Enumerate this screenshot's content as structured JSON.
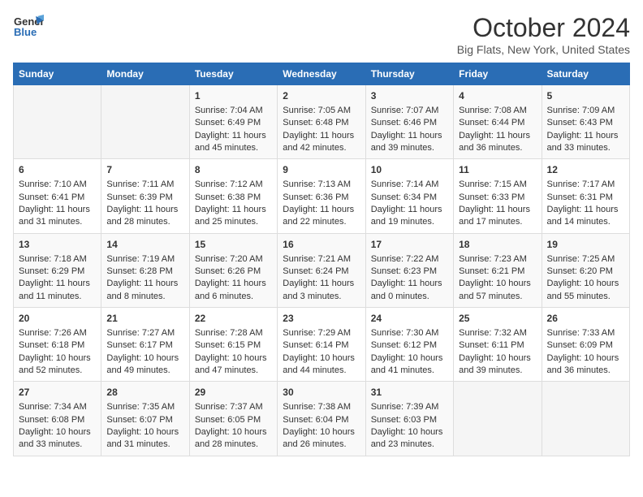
{
  "header": {
    "logo_general": "General",
    "logo_blue": "Blue",
    "month": "October 2024",
    "location": "Big Flats, New York, United States"
  },
  "days_of_week": [
    "Sunday",
    "Monday",
    "Tuesday",
    "Wednesday",
    "Thursday",
    "Friday",
    "Saturday"
  ],
  "weeks": [
    [
      {
        "day": "",
        "empty": true
      },
      {
        "day": "",
        "empty": true
      },
      {
        "day": "1",
        "sunrise": "Sunrise: 7:04 AM",
        "sunset": "Sunset: 6:49 PM",
        "daylight": "Daylight: 11 hours and 45 minutes."
      },
      {
        "day": "2",
        "sunrise": "Sunrise: 7:05 AM",
        "sunset": "Sunset: 6:48 PM",
        "daylight": "Daylight: 11 hours and 42 minutes."
      },
      {
        "day": "3",
        "sunrise": "Sunrise: 7:07 AM",
        "sunset": "Sunset: 6:46 PM",
        "daylight": "Daylight: 11 hours and 39 minutes."
      },
      {
        "day": "4",
        "sunrise": "Sunrise: 7:08 AM",
        "sunset": "Sunset: 6:44 PM",
        "daylight": "Daylight: 11 hours and 36 minutes."
      },
      {
        "day": "5",
        "sunrise": "Sunrise: 7:09 AM",
        "sunset": "Sunset: 6:43 PM",
        "daylight": "Daylight: 11 hours and 33 minutes."
      }
    ],
    [
      {
        "day": "6",
        "sunrise": "Sunrise: 7:10 AM",
        "sunset": "Sunset: 6:41 PM",
        "daylight": "Daylight: 11 hours and 31 minutes."
      },
      {
        "day": "7",
        "sunrise": "Sunrise: 7:11 AM",
        "sunset": "Sunset: 6:39 PM",
        "daylight": "Daylight: 11 hours and 28 minutes."
      },
      {
        "day": "8",
        "sunrise": "Sunrise: 7:12 AM",
        "sunset": "Sunset: 6:38 PM",
        "daylight": "Daylight: 11 hours and 25 minutes."
      },
      {
        "day": "9",
        "sunrise": "Sunrise: 7:13 AM",
        "sunset": "Sunset: 6:36 PM",
        "daylight": "Daylight: 11 hours and 22 minutes."
      },
      {
        "day": "10",
        "sunrise": "Sunrise: 7:14 AM",
        "sunset": "Sunset: 6:34 PM",
        "daylight": "Daylight: 11 hours and 19 minutes."
      },
      {
        "day": "11",
        "sunrise": "Sunrise: 7:15 AM",
        "sunset": "Sunset: 6:33 PM",
        "daylight": "Daylight: 11 hours and 17 minutes."
      },
      {
        "day": "12",
        "sunrise": "Sunrise: 7:17 AM",
        "sunset": "Sunset: 6:31 PM",
        "daylight": "Daylight: 11 hours and 14 minutes."
      }
    ],
    [
      {
        "day": "13",
        "sunrise": "Sunrise: 7:18 AM",
        "sunset": "Sunset: 6:29 PM",
        "daylight": "Daylight: 11 hours and 11 minutes."
      },
      {
        "day": "14",
        "sunrise": "Sunrise: 7:19 AM",
        "sunset": "Sunset: 6:28 PM",
        "daylight": "Daylight: 11 hours and 8 minutes."
      },
      {
        "day": "15",
        "sunrise": "Sunrise: 7:20 AM",
        "sunset": "Sunset: 6:26 PM",
        "daylight": "Daylight: 11 hours and 6 minutes."
      },
      {
        "day": "16",
        "sunrise": "Sunrise: 7:21 AM",
        "sunset": "Sunset: 6:24 PM",
        "daylight": "Daylight: 11 hours and 3 minutes."
      },
      {
        "day": "17",
        "sunrise": "Sunrise: 7:22 AM",
        "sunset": "Sunset: 6:23 PM",
        "daylight": "Daylight: 11 hours and 0 minutes."
      },
      {
        "day": "18",
        "sunrise": "Sunrise: 7:23 AM",
        "sunset": "Sunset: 6:21 PM",
        "daylight": "Daylight: 10 hours and 57 minutes."
      },
      {
        "day": "19",
        "sunrise": "Sunrise: 7:25 AM",
        "sunset": "Sunset: 6:20 PM",
        "daylight": "Daylight: 10 hours and 55 minutes."
      }
    ],
    [
      {
        "day": "20",
        "sunrise": "Sunrise: 7:26 AM",
        "sunset": "Sunset: 6:18 PM",
        "daylight": "Daylight: 10 hours and 52 minutes."
      },
      {
        "day": "21",
        "sunrise": "Sunrise: 7:27 AM",
        "sunset": "Sunset: 6:17 PM",
        "daylight": "Daylight: 10 hours and 49 minutes."
      },
      {
        "day": "22",
        "sunrise": "Sunrise: 7:28 AM",
        "sunset": "Sunset: 6:15 PM",
        "daylight": "Daylight: 10 hours and 47 minutes."
      },
      {
        "day": "23",
        "sunrise": "Sunrise: 7:29 AM",
        "sunset": "Sunset: 6:14 PM",
        "daylight": "Daylight: 10 hours and 44 minutes."
      },
      {
        "day": "24",
        "sunrise": "Sunrise: 7:30 AM",
        "sunset": "Sunset: 6:12 PM",
        "daylight": "Daylight: 10 hours and 41 minutes."
      },
      {
        "day": "25",
        "sunrise": "Sunrise: 7:32 AM",
        "sunset": "Sunset: 6:11 PM",
        "daylight": "Daylight: 10 hours and 39 minutes."
      },
      {
        "day": "26",
        "sunrise": "Sunrise: 7:33 AM",
        "sunset": "Sunset: 6:09 PM",
        "daylight": "Daylight: 10 hours and 36 minutes."
      }
    ],
    [
      {
        "day": "27",
        "sunrise": "Sunrise: 7:34 AM",
        "sunset": "Sunset: 6:08 PM",
        "daylight": "Daylight: 10 hours and 33 minutes."
      },
      {
        "day": "28",
        "sunrise": "Sunrise: 7:35 AM",
        "sunset": "Sunset: 6:07 PM",
        "daylight": "Daylight: 10 hours and 31 minutes."
      },
      {
        "day": "29",
        "sunrise": "Sunrise: 7:37 AM",
        "sunset": "Sunset: 6:05 PM",
        "daylight": "Daylight: 10 hours and 28 minutes."
      },
      {
        "day": "30",
        "sunrise": "Sunrise: 7:38 AM",
        "sunset": "Sunset: 6:04 PM",
        "daylight": "Daylight: 10 hours and 26 minutes."
      },
      {
        "day": "31",
        "sunrise": "Sunrise: 7:39 AM",
        "sunset": "Sunset: 6:03 PM",
        "daylight": "Daylight: 10 hours and 23 minutes."
      },
      {
        "day": "",
        "empty": true
      },
      {
        "day": "",
        "empty": true
      }
    ]
  ]
}
